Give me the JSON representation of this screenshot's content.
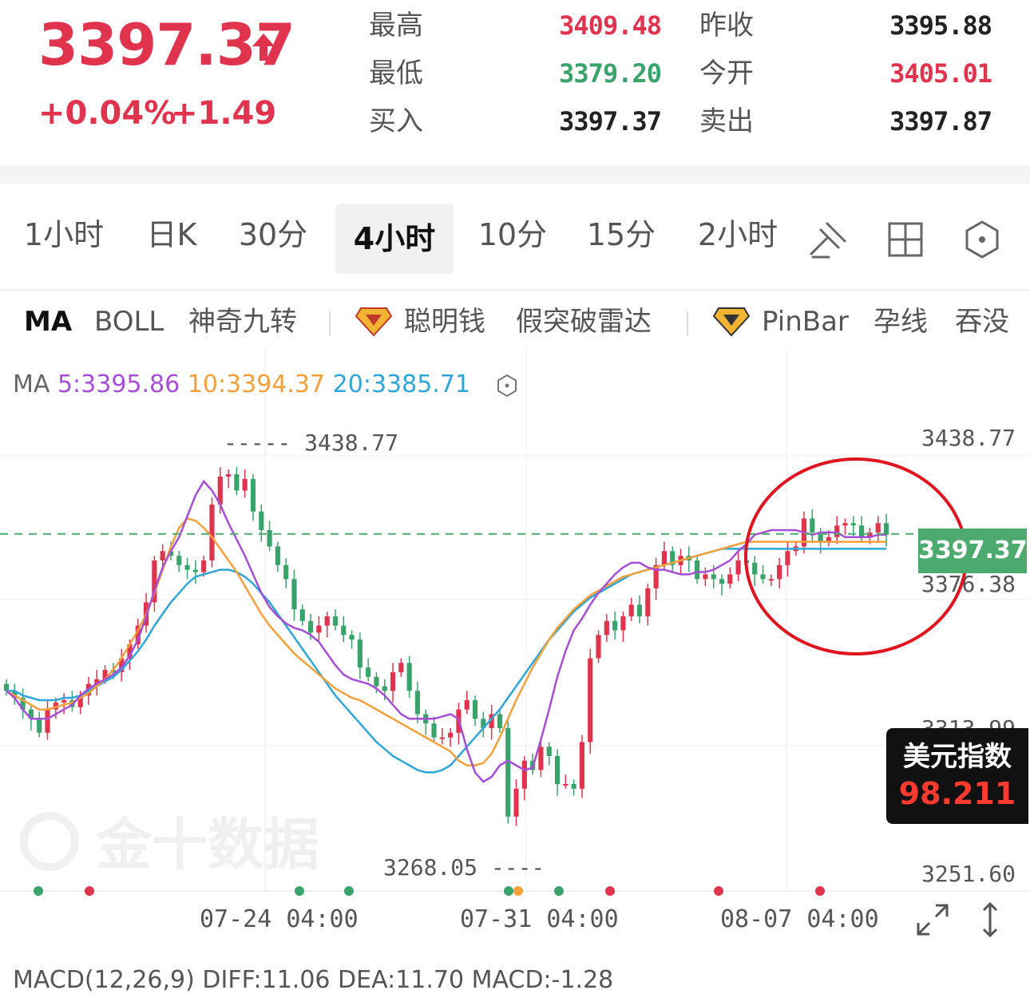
{
  "quote": {
    "price": "3397.37",
    "change_pct": "+0.04%",
    "change_abs": "+1.49",
    "stats": [
      {
        "label": "最高",
        "value": "3409.48",
        "color": "#e0344e"
      },
      {
        "label": "最低",
        "value": "3379.20",
        "color": "#3aa36b"
      },
      {
        "label": "买入",
        "value": "3397.37",
        "color": "#222222"
      },
      {
        "label": "昨收",
        "value": "3395.88",
        "color": "#222222"
      },
      {
        "label": "今开",
        "value": "3405.01",
        "color": "#e0344e"
      },
      {
        "label": "卖出",
        "value": "3397.87",
        "color": "#222222"
      }
    ]
  },
  "tabs": [
    {
      "label": "1小时",
      "active": false
    },
    {
      "label": "日K",
      "active": false
    },
    {
      "label": "30分",
      "active": false
    },
    {
      "label": "4小时",
      "active": true
    },
    {
      "label": "10分",
      "active": false
    },
    {
      "label": "15分",
      "active": false
    },
    {
      "label": "2小时",
      "active": false
    }
  ],
  "toolbar_icons": [
    "draw-tool-icon",
    "layout-grid-icon",
    "settings-hex-icon"
  ],
  "indicators": [
    "MA",
    "BOLL",
    "神奇九转",
    "聪明钱",
    "假突破雷达",
    "PinBar",
    "孕线",
    "吞没"
  ],
  "ma": {
    "prefix": "MA",
    "ma5": "5:3395.86",
    "ma10": "10:3394.37",
    "ma20": "20:3385.71",
    "colors": {
      "ma5": "#a64fd6",
      "ma10": "#f4a03a",
      "ma20": "#2fa6d8"
    }
  },
  "chart_data": {
    "type": "candlestick",
    "y_axis_labels": [
      "3438.77",
      "3376.38",
      "3313.99",
      "3251.60"
    ],
    "ylim": [
      3251.6,
      3438.77
    ],
    "x_labels": [
      "07-24 04:00",
      "07-31 04:00",
      "08-07 04:00"
    ],
    "high_label": "3438.77",
    "low_label": "3268.05",
    "current_price": "3397.37",
    "colors": {
      "up": "#e0344e",
      "down": "#3aa36b"
    },
    "closes": [
      3330,
      3327,
      3322,
      3318,
      3312,
      3322,
      3325,
      3326,
      3323,
      3328,
      3333,
      3335,
      3339,
      3338,
      3344,
      3350,
      3358,
      3368,
      3386,
      3390,
      3388,
      3384,
      3382,
      3381,
      3386,
      3410,
      3422,
      3423,
      3416,
      3421,
      3407,
      3399,
      3392,
      3384,
      3378,
      3365,
      3360,
      3355,
      3358,
      3362,
      3358,
      3354,
      3352,
      3340,
      3336,
      3332,
      3330,
      3338,
      3342,
      3330,
      3320,
      3316,
      3310,
      3310,
      3312,
      3322,
      3326,
      3318,
      3314,
      3320,
      3314,
      3276,
      3288,
      3300,
      3296,
      3306,
      3302,
      3290,
      3290,
      3288,
      3308,
      3344,
      3354,
      3360,
      3356,
      3362,
      3367,
      3362,
      3374,
      3384,
      3390,
      3384,
      3388,
      3386,
      3378,
      3380,
      3378,
      3376,
      3380,
      3386,
      3385,
      3380,
      3378,
      3378,
      3384,
      3390,
      3392,
      3404,
      3398,
      3394,
      3396,
      3401,
      3402,
      3401,
      3396,
      3398,
      3402,
      3397
    ],
    "ma5": [
      3330,
      3327,
      3322,
      3318,
      3318,
      3318,
      3320,
      3322,
      3324,
      3328,
      3331,
      3333,
      3335,
      3337,
      3340,
      3345,
      3352,
      3362,
      3373,
      3383,
      3390,
      3396,
      3405,
      3414,
      3420,
      3416,
      3410,
      3402,
      3395,
      3388,
      3380,
      3372,
      3366,
      3362,
      3359,
      3357,
      3356,
      3354,
      3351,
      3346,
      3341,
      3337,
      3335,
      3334,
      3333,
      3331,
      3328,
      3324,
      3320,
      3318,
      3318,
      3318,
      3318,
      3319,
      3320,
      3318,
      3305,
      3295,
      3291,
      3293,
      3298,
      3300,
      3298,
      3296,
      3297,
      3309,
      3322,
      3336,
      3347,
      3356,
      3361,
      3367,
      3372,
      3376,
      3380,
      3383,
      3385,
      3385,
      3383,
      3382,
      3382,
      3381,
      3380,
      3380,
      3381,
      3381,
      3382,
      3384,
      3386,
      3390,
      3393,
      3397,
      3398,
      3399,
      3399,
      3399,
      3399,
      3398,
      3397,
      3398,
      3398,
      3398,
      3396,
      3396,
      3396,
      3396,
      3397,
      3397
    ],
    "ma10": [
      3330,
      3328,
      3326,
      3324,
      3322,
      3322,
      3323,
      3324,
      3325,
      3327,
      3329,
      3332,
      3335,
      3339,
      3344,
      3350,
      3356,
      3363,
      3372,
      3382,
      3392,
      3400,
      3404,
      3403,
      3400,
      3396,
      3391,
      3386,
      3381,
      3375,
      3369,
      3363,
      3358,
      3354,
      3350,
      3346,
      3343,
      3340,
      3337,
      3334,
      3331,
      3329,
      3327,
      3326,
      3324,
      3322,
      3320,
      3318,
      3316,
      3314,
      3312,
      3310,
      3308,
      3306,
      3304,
      3300,
      3298,
      3298,
      3299,
      3303,
      3310,
      3318,
      3326,
      3333,
      3340,
      3346,
      3352,
      3357,
      3361,
      3365,
      3368,
      3371,
      3373,
      3375,
      3377,
      3379,
      3380,
      3381,
      3382,
      3383,
      3384,
      3385,
      3386,
      3387,
      3388,
      3389,
      3390,
      3391,
      3392,
      3393,
      3394,
      3394,
      3394,
      3394,
      3394,
      3394,
      3394,
      3394,
      3394,
      3394,
      3394,
      3394,
      3394,
      3394,
      3394,
      3394,
      3394,
      3394
    ],
    "ma20": [
      3330,
      3330,
      3328,
      3327,
      3326,
      3326,
      3326,
      3327,
      3327,
      3328,
      3330,
      3332,
      3334,
      3336,
      3339,
      3343,
      3347,
      3352,
      3358,
      3363,
      3368,
      3372,
      3376,
      3379,
      3380,
      3381,
      3382,
      3382,
      3381,
      3379,
      3376,
      3372,
      3368,
      3363,
      3358,
      3353,
      3348,
      3343,
      3338,
      3333,
      3328,
      3324,
      3320,
      3316,
      3312,
      3308,
      3305,
      3302,
      3300,
      3298,
      3296,
      3295,
      3295,
      3296,
      3298,
      3302,
      3306,
      3310,
      3314,
      3318,
      3322,
      3327,
      3332,
      3337,
      3342,
      3347,
      3352,
      3356,
      3360,
      3364,
      3367,
      3370,
      3372,
      3374,
      3376,
      3378,
      3380,
      3381,
      3382,
      3383,
      3384,
      3385,
      3386,
      3387,
      3388,
      3389,
      3390,
      3391,
      3391,
      3391,
      3391,
      3391,
      3391,
      3391,
      3391,
      3391,
      3391,
      3391,
      3391,
      3391,
      3391,
      3391,
      3391,
      3391,
      3391,
      3391,
      3391,
      3391
    ]
  },
  "badge": {
    "name": "美元指数",
    "value": "98.211"
  },
  "macd": {
    "text": "MACD(12,26,9) DIFF:11.06 DEA:11.70 MACD:-1.28"
  },
  "watermark": "金十数据"
}
